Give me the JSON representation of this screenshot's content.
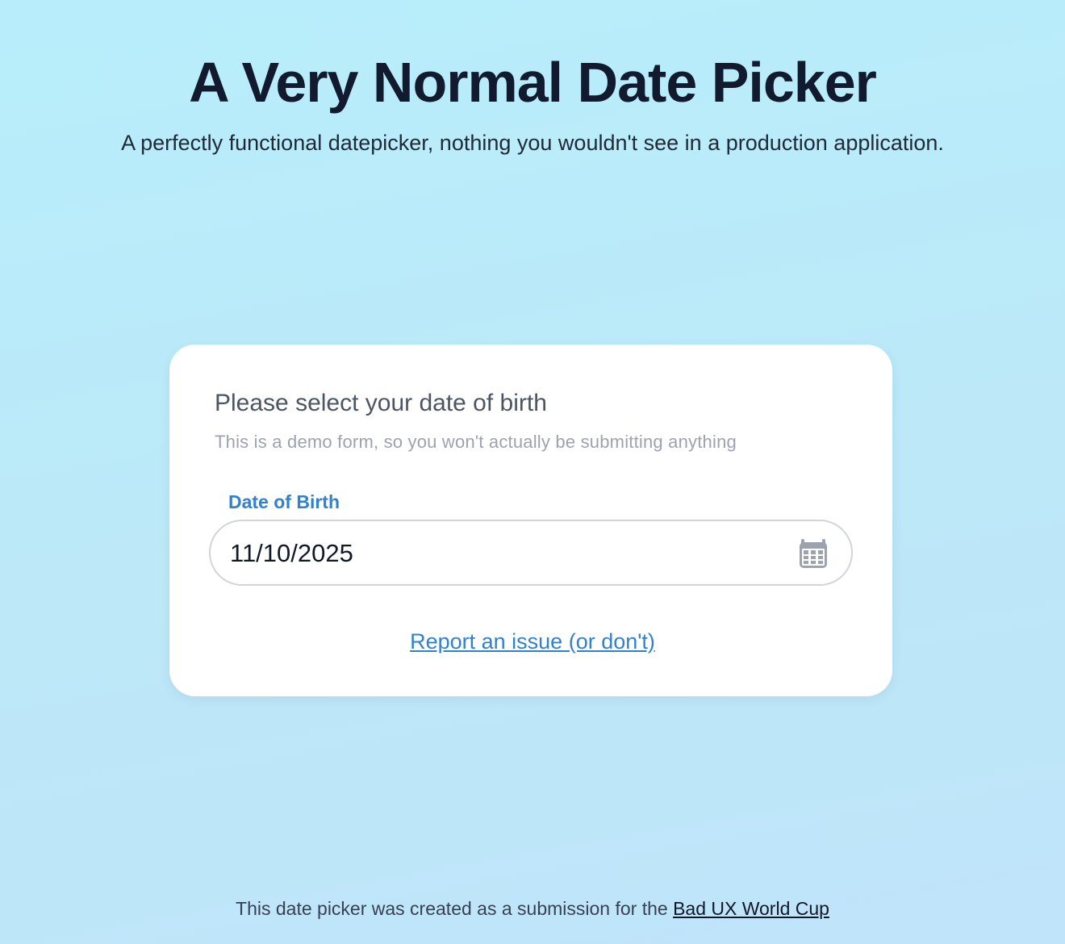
{
  "header": {
    "title": "A Very Normal Date Picker",
    "subtitle": "A perfectly functional datepicker, nothing you wouldn't see in a production application."
  },
  "form": {
    "heading": "Please select your date of birth",
    "note": "This is a demo form, so you won't actually be submitting anything",
    "field_label": "Date of Birth",
    "date_value": "11/10/2025",
    "calendar_icon": "calendar-icon",
    "report_link": "Report an issue (or don't)"
  },
  "footer": {
    "text": "This date picker was created as a submission for the",
    "link": "Bad UX World Cup"
  },
  "colors": {
    "background": "#b8eefb",
    "accent": "#3182ce",
    "title": "#111a2e",
    "card": "#ffffff"
  }
}
